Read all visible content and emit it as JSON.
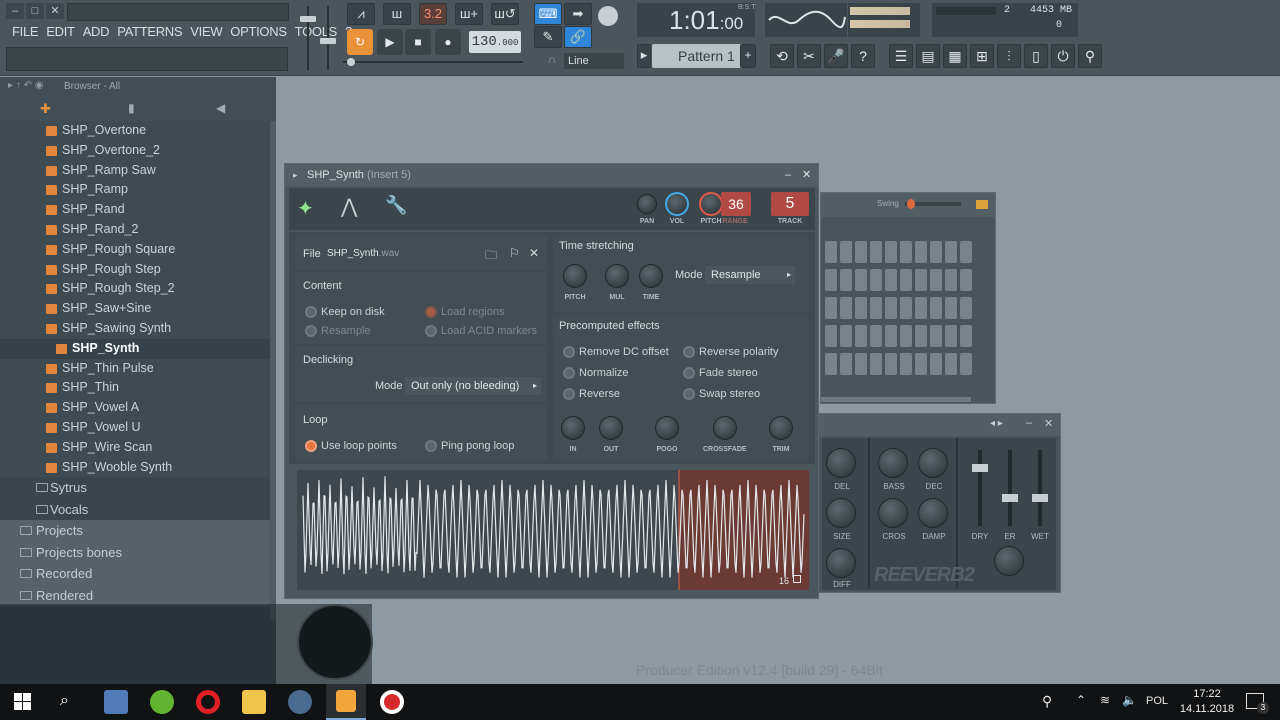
{
  "menu": [
    "FILE",
    "EDIT",
    "ADD",
    "PATTERNS",
    "VIEW",
    "OPTIONS",
    "TOOLS",
    "?"
  ],
  "window_buttons": [
    "–",
    "□",
    "✕"
  ],
  "toolbar": {
    "tempo_main": "130",
    "tempo_frac": ".000",
    "snap_label": "3.2",
    "time": "1:01",
    "time_frac": ":00",
    "time_format": "B:S:T",
    "pattern": "Pattern 1",
    "line_mode": "Line",
    "cpu_count": "2",
    "memory": "4453 MB",
    "polyphony": "0"
  },
  "browser": {
    "title": "Browser - All",
    "items": [
      "SHP_Overtone",
      "SHP_Overtone_2",
      "SHP_Ramp Saw",
      "SHP_Ramp",
      "SHP_Rand",
      "SHP_Rand_2",
      "SHP_Rough Square",
      "SHP_Rough Step",
      "SHP_Rough Step_2",
      "SHP_Saw+Sine",
      "SHP_Sawing Synth",
      "SHP_Synth",
      "SHP_Thin Pulse",
      "SHP_Thin",
      "SHP_Vowel A",
      "SHP_Vowel U",
      "SHP_Wire Scan",
      "SHP_Wooble Synth"
    ],
    "selected": "SHP_Synth",
    "subfolders": [
      "Sytrus",
      "Vocals"
    ],
    "folders": [
      "Projects",
      "Projects bones",
      "Recorded",
      "Rendered"
    ]
  },
  "plugin": {
    "title": "SHP_Synth",
    "insert": "(Insert 5)",
    "pan_label": "PAN",
    "vol_label": "VOL",
    "pitch_label": "PITCH",
    "range_label": "RANGE",
    "range_value": "36",
    "track_label": "TRACK",
    "track_value": "5",
    "file_label": "File",
    "file_name": "SHP_Synth",
    "file_ext": ".wav",
    "content_label": "Content",
    "keep_on_disk": "Keep on disk",
    "resample_opt": "Resample",
    "load_regions": "Load regions",
    "load_acid": "Load ACID markers",
    "declicking_label": "Declicking",
    "mode_label": "Mode",
    "declick_mode": "Out only (no bleeding)",
    "loop_label": "Loop",
    "use_loop": "Use loop points",
    "ping_pong": "Ping pong loop",
    "time_stretch_label": "Time stretching",
    "ts_mode": "Resample",
    "ts_knobs": [
      "PITCH",
      "MUL",
      "TIME"
    ],
    "precomputed_label": "Precomputed effects",
    "effects": [
      "Remove DC offset",
      "Normalize",
      "Reverse",
      "Reverse polarity",
      "Fade stereo",
      "Swap stereo"
    ],
    "fx_knobs": [
      "IN",
      "OUT",
      "POGO",
      "CROSSFADE",
      "TRIM"
    ],
    "wave_marker": "16"
  },
  "rack": {
    "swing_label": "Swing"
  },
  "reverb": {
    "knobs": [
      "DEL",
      "BASS",
      "DEC",
      "SIZE",
      "CROS",
      "DAMP",
      "DIFF"
    ],
    "faders": [
      "DRY",
      "ER",
      "WET"
    ],
    "logo": "REEVERB2"
  },
  "edition": "Producer Edition v12.4 [build 29] - 64Bit",
  "taskbar": {
    "language": "POL",
    "time": "17:22",
    "date": "14.11.2018",
    "notif_count": "3"
  },
  "colors": {
    "accent_orange": "#e9923a",
    "accent_blue": "#2f86d9",
    "loop_region": "#6b3a33",
    "active_radio": "#e7743f"
  }
}
